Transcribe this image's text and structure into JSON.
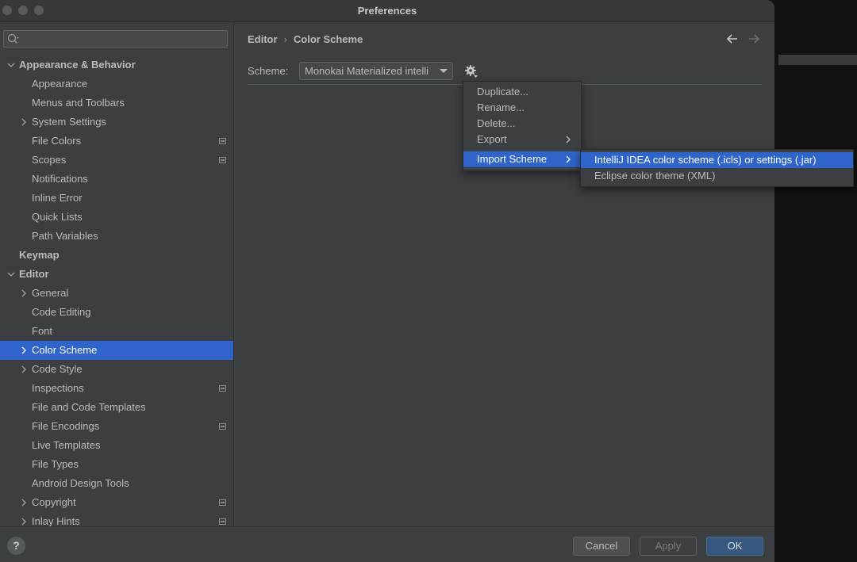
{
  "window": {
    "title": "Preferences"
  },
  "search": {
    "placeholder": ""
  },
  "sidebar": {
    "items": [
      {
        "label": "Appearance & Behavior",
        "bold": true,
        "expanded": true,
        "indent": 0
      },
      {
        "label": "Appearance",
        "indent": 1
      },
      {
        "label": "Menus and Toolbars",
        "indent": 1
      },
      {
        "label": "System Settings",
        "indent": 1,
        "collapsed": true
      },
      {
        "label": "File Colors",
        "indent": 1,
        "project": true
      },
      {
        "label": "Scopes",
        "indent": 1,
        "project": true
      },
      {
        "label": "Notifications",
        "indent": 1
      },
      {
        "label": "Inline Error",
        "indent": 1
      },
      {
        "label": "Quick Lists",
        "indent": 1
      },
      {
        "label": "Path Variables",
        "indent": 1
      },
      {
        "label": "Keymap",
        "bold": true,
        "indent": 0
      },
      {
        "label": "Editor",
        "bold": true,
        "expanded": true,
        "indent": 0
      },
      {
        "label": "General",
        "indent": 1,
        "collapsed": true
      },
      {
        "label": "Code Editing",
        "indent": 1
      },
      {
        "label": "Font",
        "indent": 1
      },
      {
        "label": "Color Scheme",
        "indent": 1,
        "collapsed": true,
        "selected": true
      },
      {
        "label": "Code Style",
        "indent": 1,
        "collapsed": true
      },
      {
        "label": "Inspections",
        "indent": 1,
        "project": true
      },
      {
        "label": "File and Code Templates",
        "indent": 1
      },
      {
        "label": "File Encodings",
        "indent": 1,
        "project": true
      },
      {
        "label": "Live Templates",
        "indent": 1
      },
      {
        "label": "File Types",
        "indent": 1
      },
      {
        "label": "Android Design Tools",
        "indent": 1
      },
      {
        "label": "Copyright",
        "indent": 1,
        "collapsed": true,
        "project": true
      },
      {
        "label": "Inlay Hints",
        "indent": 1,
        "collapsed": true,
        "project": true
      }
    ]
  },
  "breadcrumb": {
    "parent": "Editor",
    "separator": "›",
    "current": "Color Scheme"
  },
  "scheme": {
    "label": "Scheme:",
    "value": "Monokai Materialized intelli"
  },
  "menu": {
    "items": [
      {
        "label": "Duplicate..."
      },
      {
        "label": "Rename..."
      },
      {
        "label": "Delete..."
      },
      {
        "label": "Export",
        "has_submenu": true
      },
      {
        "label": "Import Scheme",
        "has_submenu": true,
        "active": true
      }
    ]
  },
  "submenu": {
    "items": [
      {
        "label": "IntelliJ IDEA color scheme (.icls) or settings (.jar)",
        "active": true
      },
      {
        "label": "Eclipse color theme (XML)"
      }
    ]
  },
  "footer": {
    "help": "?",
    "cancel": "Cancel",
    "apply": "Apply",
    "ok": "OK"
  },
  "colors": {
    "selection": "#2f65ca",
    "background": "#3c3f41",
    "primary_button": "#365880"
  }
}
